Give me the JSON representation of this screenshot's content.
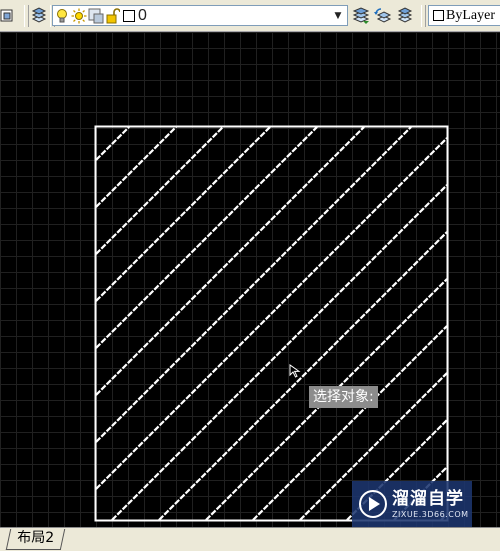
{
  "toolbar": {
    "left_icons": [
      "layer-states-icon",
      "layer-manager-icon"
    ],
    "layer_icons": [
      "lightbulb-on-icon",
      "sun-thaw-icon",
      "viewport-freeze-icon",
      "unlock-icon",
      "color-square-icon"
    ],
    "layer_name": "0",
    "right_icons": [
      "make-current-layer-icon",
      "layer-previous-icon",
      "layer-match-icon"
    ],
    "color_control": "ByLayer",
    "colors": {
      "bar": "#ece9d8",
      "accent": "#1c366e"
    }
  },
  "drawing": {
    "background": "#000000",
    "tooltip": "选择对象:",
    "watermark": {
      "title": "溜溜自学",
      "url": "ZIXUE.3D66.COM"
    }
  },
  "tabs": {
    "layout2": "布局2"
  }
}
